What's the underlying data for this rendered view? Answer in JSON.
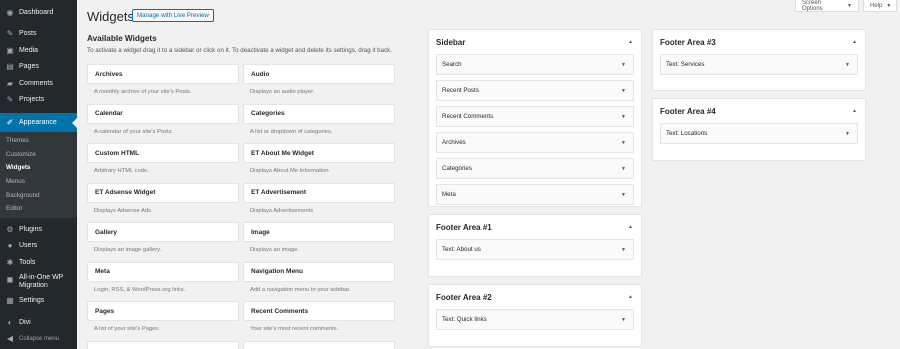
{
  "admin_menu": {
    "items": [
      {
        "label": "Dashboard",
        "icon": "dashboard-icon",
        "glyph": "◉"
      },
      {
        "label": "Posts",
        "icon": "pin-icon",
        "glyph": "✎"
      },
      {
        "label": "Media",
        "icon": "media-icon",
        "glyph": "▣"
      },
      {
        "label": "Pages",
        "icon": "page-icon",
        "glyph": "▤"
      },
      {
        "label": "Comments",
        "icon": "comment-icon",
        "glyph": "▰"
      },
      {
        "label": "Projects",
        "icon": "pin-icon",
        "glyph": "✎"
      },
      {
        "label": "Appearance",
        "icon": "brush-icon",
        "glyph": "✐"
      },
      {
        "label": "Plugins",
        "icon": "plug-icon",
        "glyph": "⚙"
      },
      {
        "label": "Users",
        "icon": "user-icon",
        "glyph": "●"
      },
      {
        "label": "Tools",
        "icon": "wrench-icon",
        "glyph": "✱"
      },
      {
        "label": "All-in-One WP Migration",
        "icon": "migration-icon",
        "glyph": "◼"
      },
      {
        "label": "Settings",
        "icon": "settings-icon",
        "glyph": "▦"
      },
      {
        "label": "Divi",
        "icon": "divi-icon",
        "glyph": "◐"
      },
      {
        "label": "Collapse menu",
        "icon": "collapse-icon",
        "glyph": "◀"
      }
    ],
    "appearance_sub": [
      "Themes",
      "Customize",
      "Widgets",
      "Menus",
      "Background",
      "Editor"
    ]
  },
  "top": {
    "screen_options": "Screen Options",
    "help": "Help",
    "arrow": "▼"
  },
  "header": {
    "title": "Widgets",
    "live_preview": "Manage with Live Preview"
  },
  "available": {
    "title": "Available Widgets",
    "description": "To activate a widget drag it to a sidebar or click on it. To deactivate a widget and delete its settings, drag it back.",
    "widgets": [
      {
        "name": "Archives",
        "desc": "A monthly archive of your site's Posts."
      },
      {
        "name": "Audio",
        "desc": "Displays an audio player."
      },
      {
        "name": "Calendar",
        "desc": "A calendar of your site's Posts."
      },
      {
        "name": "Categories",
        "desc": "A list or dropdown of categories."
      },
      {
        "name": "Custom HTML",
        "desc": "Arbitrary HTML code."
      },
      {
        "name": "ET About Me Widget",
        "desc": "Displays About Me Information"
      },
      {
        "name": "ET Adsense Widget",
        "desc": "Displays Adsense Ads"
      },
      {
        "name": "ET Advertisement",
        "desc": "Displays Advertisements"
      },
      {
        "name": "Gallery",
        "desc": "Displays an image gallery."
      },
      {
        "name": "Image",
        "desc": "Displays an image."
      },
      {
        "name": "Meta",
        "desc": "Login, RSS, & WordPress.org links."
      },
      {
        "name": "Navigation Menu",
        "desc": "Add a navigation menu to your sidebar."
      },
      {
        "name": "Pages",
        "desc": "A list of your site's Pages."
      },
      {
        "name": "Recent Comments",
        "desc": "Your site's most recent comments."
      }
    ]
  },
  "areas": {
    "toggle_up": "▲",
    "toggle_down": "▼",
    "sidebar": {
      "title": "Sidebar",
      "widgets": [
        "Search",
        "Recent Posts",
        "Recent Comments",
        "Archives",
        "Categories",
        "Meta"
      ]
    },
    "footer1": {
      "title": "Footer Area #1",
      "widgets": [
        "Text: About us"
      ]
    },
    "footer2": {
      "title": "Footer Area #2",
      "widgets": [
        "Text: Quick links"
      ]
    },
    "footer3": {
      "title": "Footer Area #3",
      "widgets": [
        "Text: Services"
      ]
    },
    "footer4": {
      "title": "Footer Area #4",
      "widgets": [
        "Text: Locations"
      ]
    }
  }
}
